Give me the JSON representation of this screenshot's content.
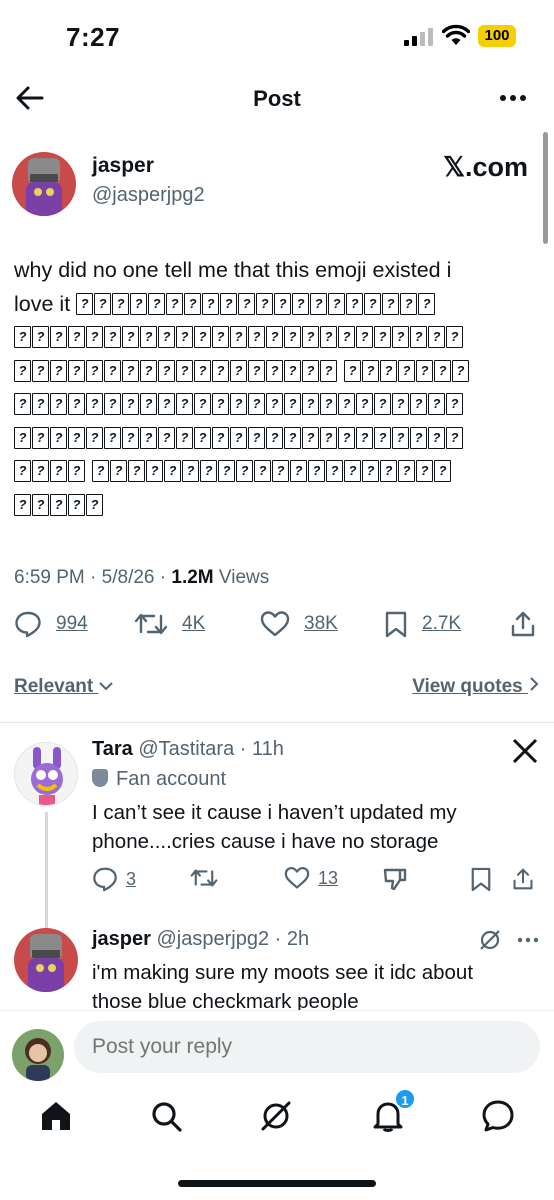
{
  "status": {
    "time": "7:27",
    "battery": "100"
  },
  "nav": {
    "title": "Post"
  },
  "post": {
    "author_name": "jasper",
    "author_handle": "@jasperjpg2",
    "source": "𝕏.com",
    "text_line1": "why did no one tell me that this emoji existed i",
    "text_line2_prefix": "love it",
    "time": "6:59 PM",
    "date": "5/8/26",
    "views_count": "1.2M",
    "views_label": "Views",
    "replies": "994",
    "reposts": "4K",
    "likes": "38K",
    "bookmarks": "2.7K"
  },
  "filters": {
    "sort_label": "Relevant",
    "view_quotes": "View quotes"
  },
  "replies": [
    {
      "name": "Tara",
      "handle": "@Tastitara",
      "age": "11h",
      "label": "Fan account",
      "text": "I can’t see it cause i haven’t updated my phone....cries cause i have no storage",
      "replies": "3",
      "likes": "13"
    },
    {
      "name": "jasper",
      "handle": "@jasperjpg2",
      "age": "2h",
      "text": "i'm making sure my moots see it idc about those blue checkmark people"
    }
  ],
  "composer": {
    "placeholder": "Post your reply"
  },
  "tabs": {
    "notifications_badge": "1"
  },
  "icons": [
    "back-arrow-icon",
    "more-icon",
    "x-logo-icon",
    "reply-icon",
    "repost-icon",
    "like-icon",
    "bookmark-icon",
    "share-icon",
    "grok-icon",
    "home-icon",
    "search-icon",
    "bell-icon",
    "messages-icon"
  ],
  "colors": {
    "accent": "#1d9bf0",
    "muted": "#536471",
    "text": "#0f1419",
    "battery": "#f5d000"
  }
}
